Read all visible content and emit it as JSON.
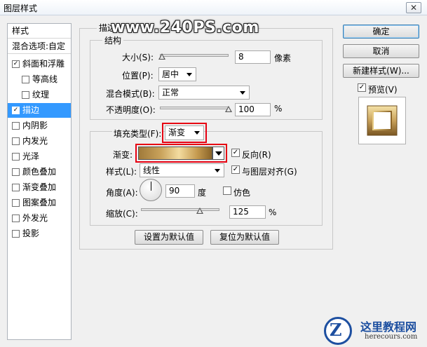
{
  "window": {
    "title": "图层样式",
    "close_label": "✕"
  },
  "watermark": "www.240PS.com",
  "sidebar": {
    "header": "样式",
    "blend_options": "混合选项:自定",
    "items": [
      {
        "label": "斜面和浮雕",
        "checked": "✓"
      },
      {
        "label": "等高线",
        "checked": ""
      },
      {
        "label": "纹理",
        "checked": ""
      },
      {
        "label": "描边",
        "checked": "✓"
      },
      {
        "label": "内阴影",
        "checked": ""
      },
      {
        "label": "内发光",
        "checked": ""
      },
      {
        "label": "光泽",
        "checked": ""
      },
      {
        "label": "颜色叠加",
        "checked": ""
      },
      {
        "label": "渐变叠加",
        "checked": ""
      },
      {
        "label": "图案叠加",
        "checked": ""
      },
      {
        "label": "外发光",
        "checked": ""
      },
      {
        "label": "投影",
        "checked": ""
      }
    ]
  },
  "stroke": {
    "group_title": "描边",
    "structure": {
      "title": "结构",
      "size_label": "大小(S):",
      "size_value": "8",
      "size_unit": "像素",
      "size_level": 0.03,
      "position_label": "位置(P):",
      "position_value": "居中",
      "blend_label": "混合模式(B):",
      "blend_value": "正常",
      "opacity_label": "不透明度(O):",
      "opacity_value": "100",
      "opacity_unit": "%",
      "opacity_level": 1.0
    },
    "fill": {
      "type_label": "填充类型(F):",
      "type_value": "渐变",
      "gradient_label": "渐变:",
      "reverse_label": "反向(R)",
      "reverse_checked": "✓",
      "style_label": "样式(L):",
      "style_value": "线性",
      "align_label": "与图层对齐(G)",
      "align_checked": "✓",
      "angle_label": "角度(A):",
      "angle_value": "90",
      "angle_unit": "度",
      "dither_label": "仿色",
      "dither_checked": "",
      "scale_label": "缩放(C):",
      "scale_value": "125",
      "scale_unit": "%",
      "scale_level": 0.75
    },
    "make_default": "设置为默认值",
    "reset_default": "复位为默认值"
  },
  "buttons": {
    "ok": "确定",
    "cancel": "取消",
    "new_style": "新建样式(W)...",
    "preview_label": "预览(V)",
    "preview_checked": "✓"
  },
  "logo": {
    "title": "这里教程网",
    "url": "herecours.com"
  },
  "colors": {
    "selection": "#3399ff",
    "highlight_red": "#e60012",
    "gold_dark": "#a07a3a",
    "gold_light": "#f3dca0"
  }
}
